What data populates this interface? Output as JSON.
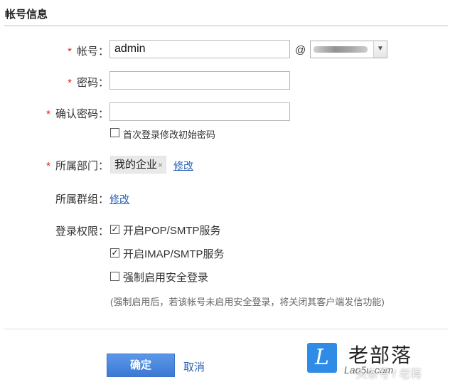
{
  "section": {
    "title": "帐号信息"
  },
  "form": {
    "required_mark": "*",
    "account": {
      "label": "帐号：",
      "value": "admin",
      "at": "@"
    },
    "password": {
      "label": "密码：",
      "value": ""
    },
    "confirm_password": {
      "label": "确认密码：",
      "value": ""
    },
    "first_login_change": {
      "label": "首次登录修改初始密码",
      "checked": false
    },
    "department": {
      "label": "所属部门：",
      "tag": "我的企业",
      "tag_close": "×",
      "edit": "修改"
    },
    "group": {
      "label": "所属群组：",
      "edit": "修改"
    },
    "login_permissions": {
      "label": "登录权限：",
      "options": [
        {
          "label": "开启POP/SMTP服务",
          "checked": true
        },
        {
          "label": "开启IMAP/SMTP服务",
          "checked": true
        },
        {
          "label": "强制启用安全登录",
          "checked": false
        }
      ],
      "hint": "(强制启用后，若该帐号未启用安全登录，将关闭其客户端发信功能)"
    }
  },
  "actions": {
    "confirm": "确定",
    "cancel": "取消"
  },
  "watermark": {
    "logo_letter": "L",
    "title": "老部落",
    "subtitle": "Lao5u.com",
    "overlay": "头条号 / 老蒋"
  },
  "colors": {
    "required": "#d9241c",
    "link": "#2a62b5",
    "primary_button": "#4a86dd",
    "logo": "#2f8ce6"
  },
  "icons": {
    "checked": "☑",
    "unchecked": "☐",
    "dropdown": "chevron-down-icon"
  }
}
